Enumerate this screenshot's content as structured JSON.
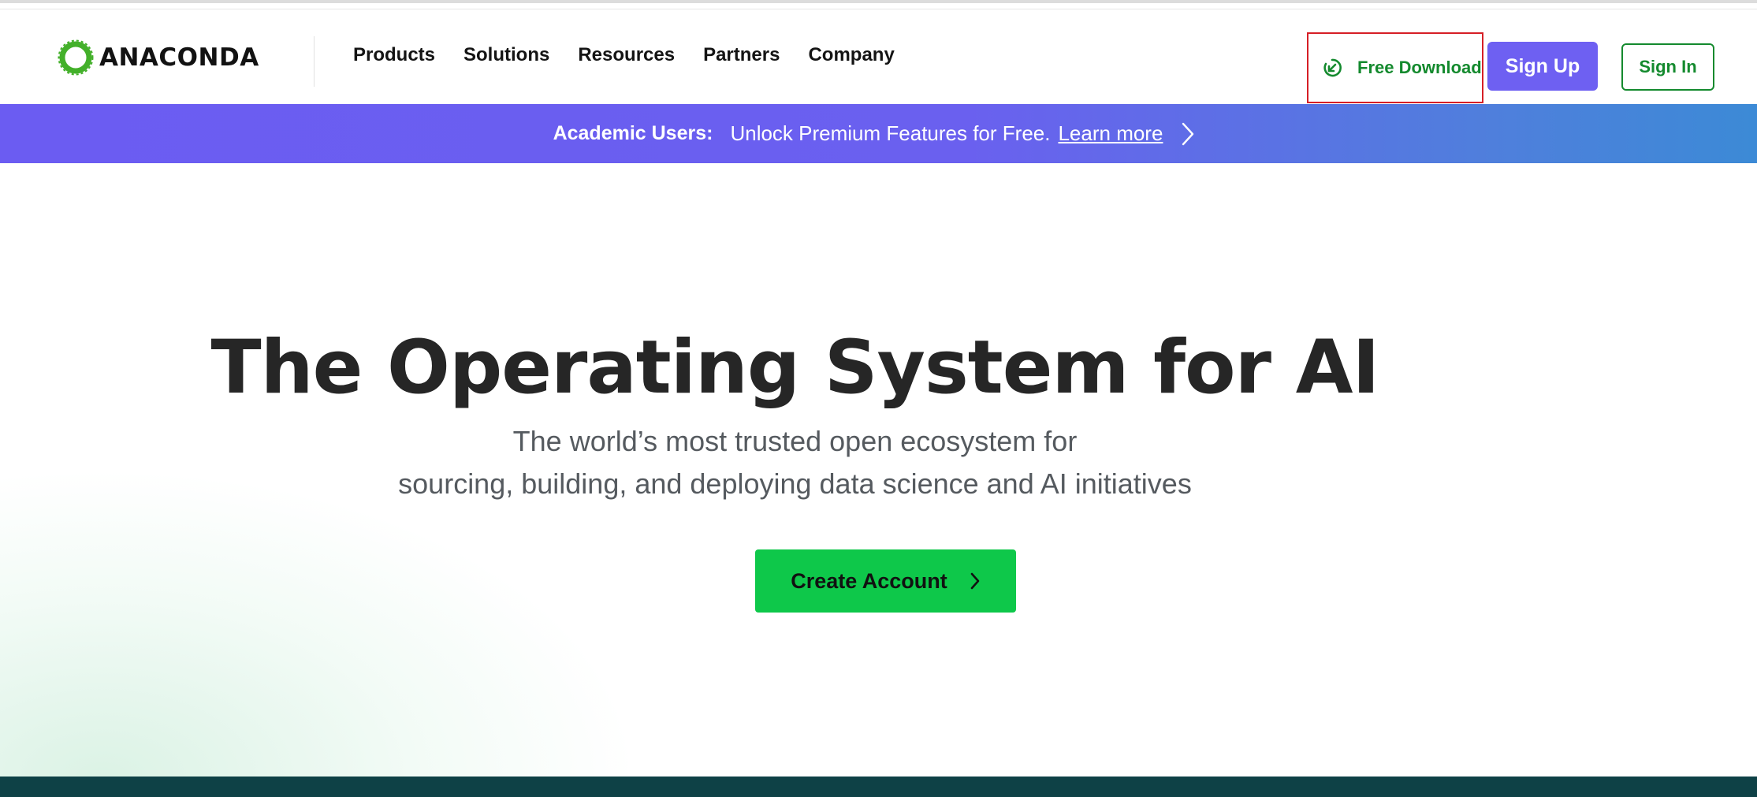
{
  "brand": {
    "name": "ANACONDA",
    "logo_icon": "anaconda-ring-logo",
    "accent_green": "#148a2e",
    "cta_green": "#0ec84a",
    "accent_purple": "#6e60f2"
  },
  "nav": {
    "links": [
      "Products",
      "Solutions",
      "Resources",
      "Partners",
      "Company"
    ],
    "free_download": {
      "label": "Free Download",
      "icon": "download-circle-icon"
    },
    "sign_up": "Sign Up",
    "sign_in": "Sign In"
  },
  "banner": {
    "bold": "Academic Users:",
    "text": "Unlock Premium Features for Free.",
    "link": "Learn more",
    "icon": "chevron-right-icon"
  },
  "hero": {
    "title": "The Operating System for AI",
    "subtitle_line1": "The world’s most trusted open ecosystem for",
    "subtitle_line2": "sourcing, building, and deploying data science and AI initiatives",
    "cta": "Create Account"
  }
}
